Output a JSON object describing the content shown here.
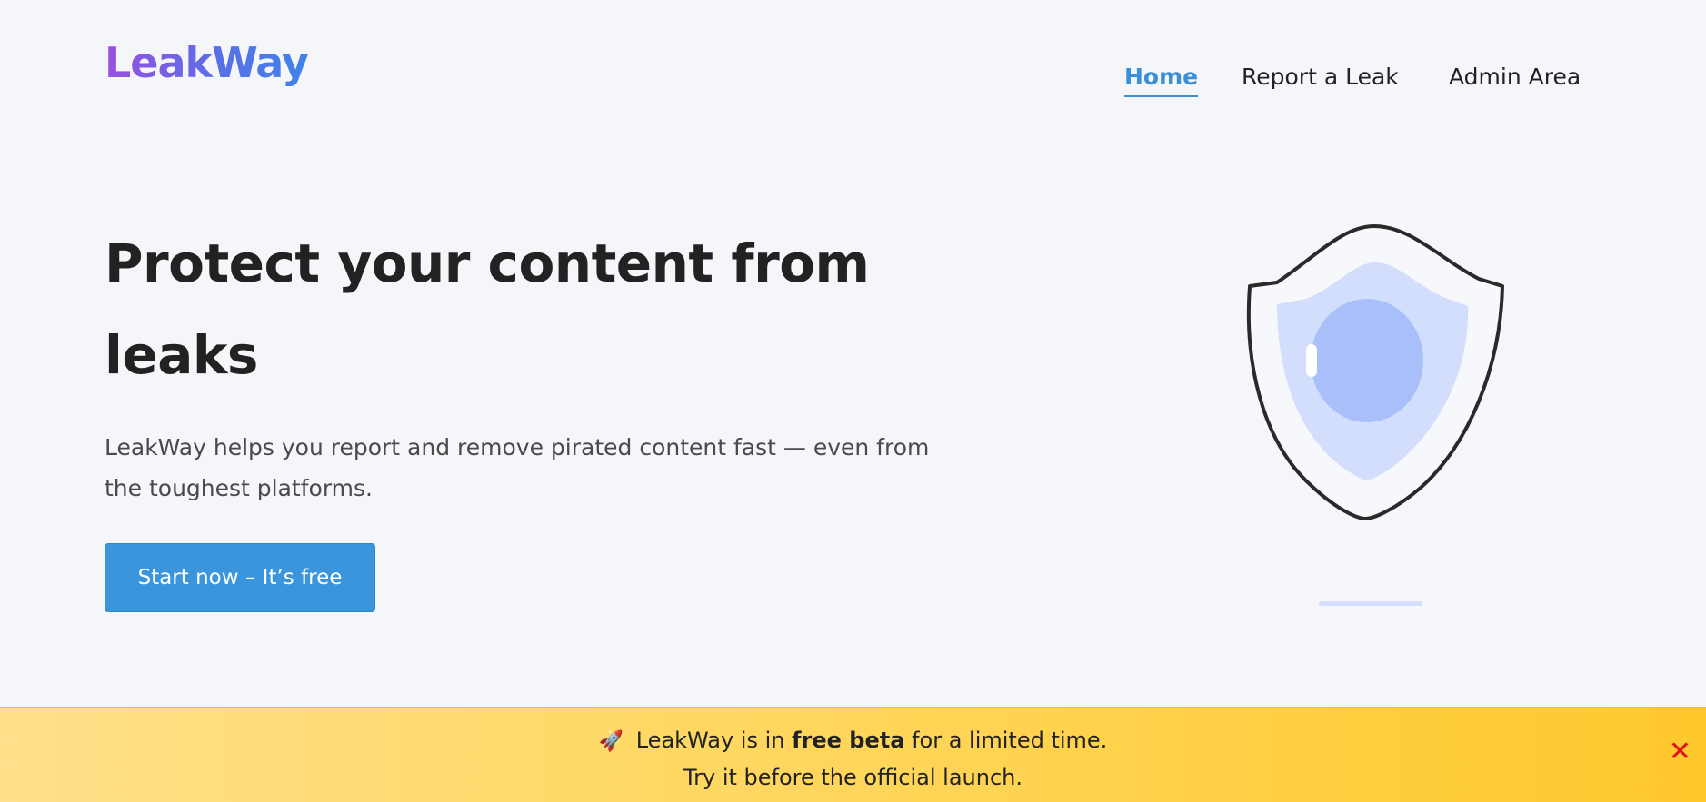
{
  "brand": {
    "name": "LeakWay"
  },
  "nav": {
    "items": [
      {
        "label": "Home",
        "active": true
      },
      {
        "label": "Report a Leak",
        "active": false
      },
      {
        "label": "Admin Area",
        "active": false
      }
    ]
  },
  "hero": {
    "title": "Protect your content from leaks",
    "subtitle": "LeakWay helps you report and remove pirated content fast — even from the toughest platforms.",
    "cta_label": "Start now – It’s free"
  },
  "illustration": {
    "icon": "shield-icon"
  },
  "banner": {
    "icon": "rocket-icon",
    "icon_glyph": "🚀",
    "text_before": "LeakWay is in",
    "text_bold": "free beta",
    "text_after": "for a limited time.",
    "line2": "Try it before the official launch.",
    "close_glyph": "✕"
  },
  "colors": {
    "accent": "#3a95dc",
    "nav_active": "#3a8fd8",
    "logo_gradient_start": "#9a4fe0",
    "logo_gradient_end": "#3f84e8",
    "banner_bg": "#ffd65a",
    "close": "#e01010"
  }
}
